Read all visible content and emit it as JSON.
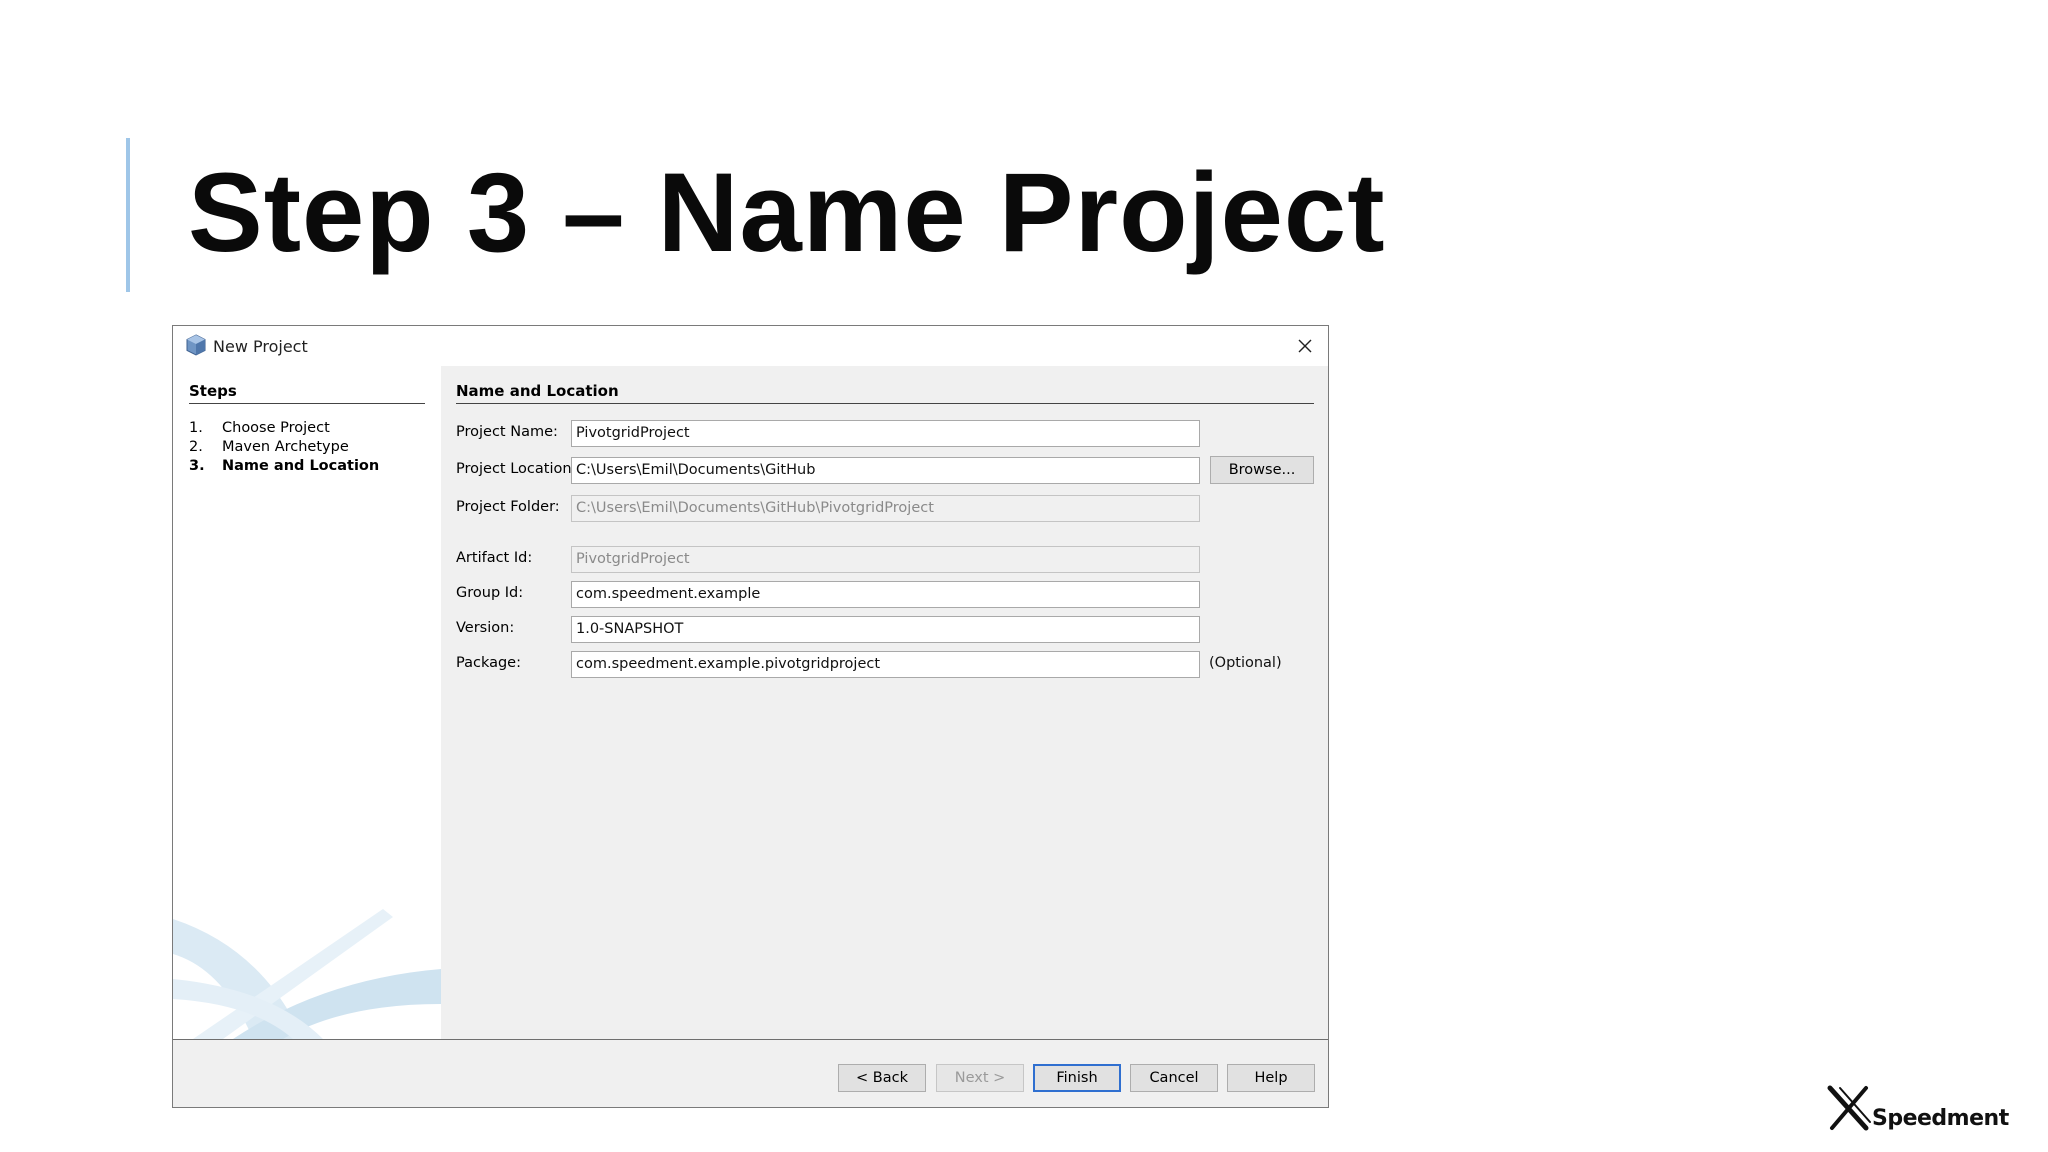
{
  "slide": {
    "title": "Step 3 – Name Project",
    "accent_color": "#9fc6e8",
    "logo_text": "Speedment"
  },
  "dialog": {
    "title": "New Project",
    "app_icon": "netbeans-cube-icon",
    "close_icon": "close-icon",
    "steps": {
      "header": "Steps",
      "items": [
        {
          "num": "1.",
          "label": "Choose Project"
        },
        {
          "num": "2.",
          "label": "Maven Archetype"
        },
        {
          "num": "3.",
          "label": "Name and Location"
        }
      ],
      "current_index": 2
    },
    "section_header": "Name and Location",
    "fields": {
      "project_name": {
        "label": "Project Name:",
        "value": "PivotgridProject"
      },
      "project_location": {
        "label": "Project Location:",
        "value": "C:\\Users\\Emil\\Documents\\GitHub"
      },
      "project_folder": {
        "label": "Project Folder:",
        "value": "C:\\Users\\Emil\\Documents\\GitHub\\PivotgridProject"
      },
      "artifact_id": {
        "label": "Artifact Id:",
        "value": "PivotgridProject"
      },
      "group_id": {
        "label": "Group Id:",
        "value": "com.speedment.example"
      },
      "version": {
        "label": "Version:",
        "value": "1.0-SNAPSHOT"
      },
      "package": {
        "label": "Package:",
        "value": "com.speedment.example.pivotgridproject",
        "note": "(Optional)"
      }
    },
    "buttons": {
      "browse": "Browse...",
      "back": "< Back",
      "next": "Next >",
      "finish": "Finish",
      "cancel": "Cancel",
      "help": "Help"
    }
  }
}
